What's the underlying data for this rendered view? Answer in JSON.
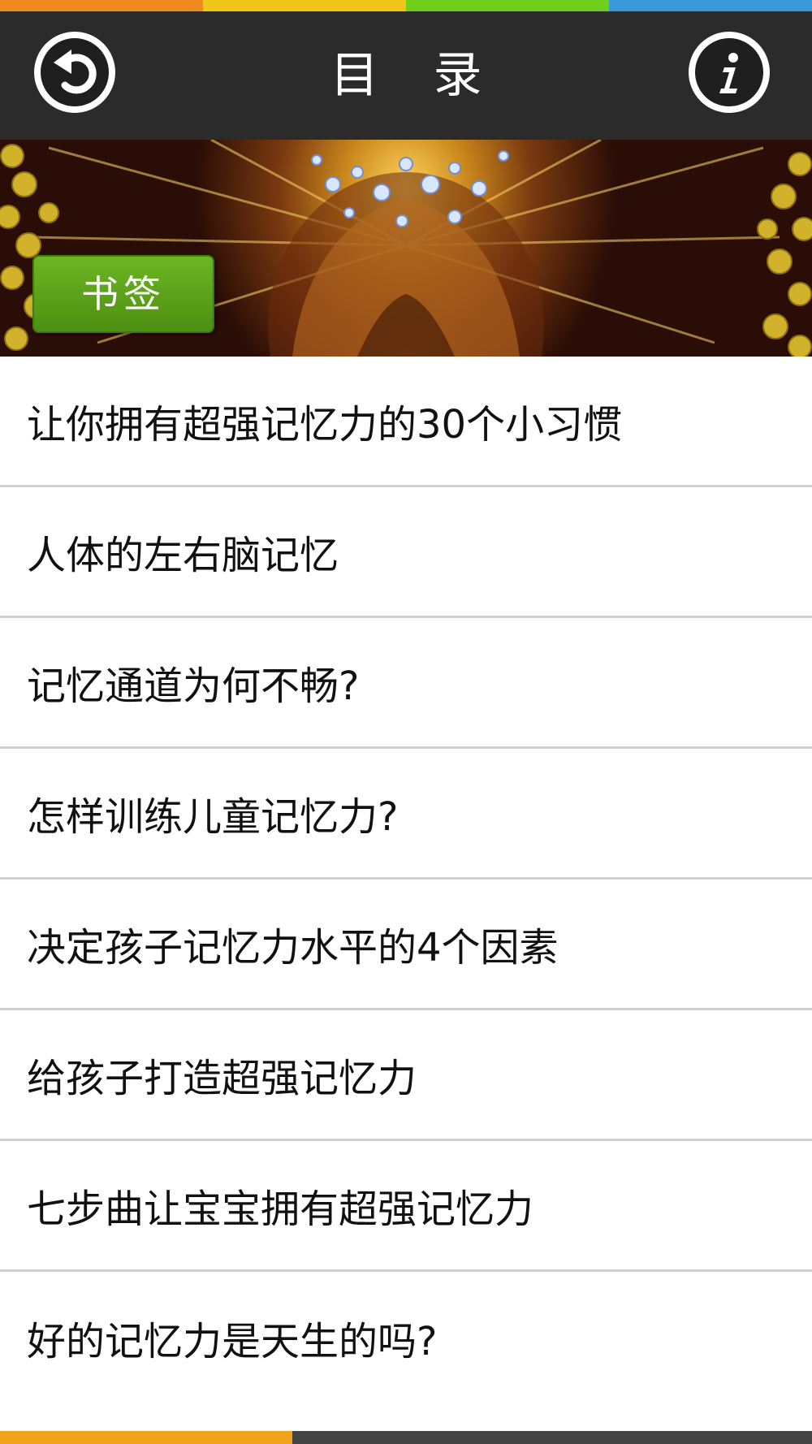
{
  "colors": {
    "stripe": [
      "#f08a1e",
      "#f0c419",
      "#6ed01c",
      "#3a9ad9"
    ],
    "navbar": "#2b2b2b",
    "bookmark": "#5ba31a",
    "bottom_stripe": [
      "#f0a41c",
      "#444444"
    ]
  },
  "header": {
    "title": "目 录",
    "back_icon": "back-arrow-icon",
    "info_icon": "info-icon"
  },
  "banner": {
    "bookmark_label": "书签"
  },
  "chapters": [
    {
      "title": "让你拥有超强记忆力的30个小习惯"
    },
    {
      "title": "人体的左右脑记忆"
    },
    {
      "title": "记忆通道为何不畅?"
    },
    {
      "title": "怎样训练儿童记忆力?"
    },
    {
      "title": "决定孩子记忆力水平的4个因素"
    },
    {
      "title": "给孩子打造超强记忆力"
    },
    {
      "title": "七步曲让宝宝拥有超强记忆力"
    },
    {
      "title": "好的记忆力是天生的吗?"
    }
  ]
}
